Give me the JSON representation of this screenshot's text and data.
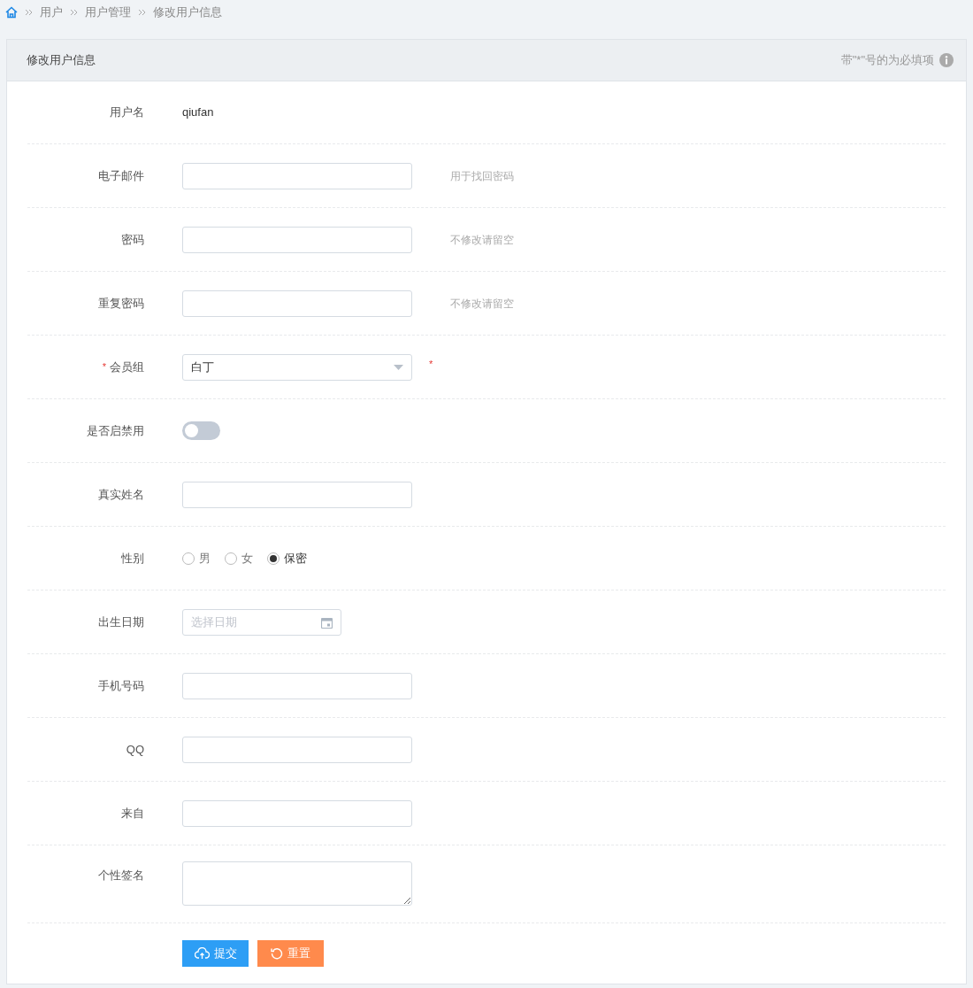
{
  "breadcrumb": [
    "用户",
    "用户管理",
    "修改用户信息"
  ],
  "panel": {
    "title": "修改用户信息",
    "note": "带\"*\"号的为必填项"
  },
  "fields": [
    {
      "kind": "text",
      "label": "用户名",
      "value": "qiufan"
    },
    {
      "kind": "input",
      "label": "电子邮件",
      "hint": "用于找回密码"
    },
    {
      "kind": "input",
      "label": "密码",
      "hint": "不修改请留空"
    },
    {
      "kind": "input",
      "label": "重复密码",
      "hint": "不修改请留空"
    },
    {
      "kind": "select",
      "label": "会员组",
      "label_mark": "*",
      "value": "白丁",
      "after_mark": "*"
    },
    {
      "kind": "switch",
      "label": "是否启禁用",
      "on": false
    },
    {
      "kind": "input",
      "label": "真实姓名"
    },
    {
      "kind": "radio",
      "label": "性别",
      "options": [
        {
          "label": "男",
          "selected": false
        },
        {
          "label": "女",
          "selected": false
        },
        {
          "label": "保密",
          "selected": true
        }
      ]
    },
    {
      "kind": "date",
      "label": "出生日期",
      "placeholder": "选择日期"
    },
    {
      "kind": "input",
      "label": "手机号码"
    },
    {
      "kind": "input",
      "label": "QQ"
    },
    {
      "kind": "input",
      "label": "来自"
    },
    {
      "kind": "textarea",
      "label": "个性签名"
    }
  ],
  "buttons": [
    {
      "kind": "submit",
      "label": "提交"
    },
    {
      "kind": "reset",
      "label": "重置"
    }
  ]
}
